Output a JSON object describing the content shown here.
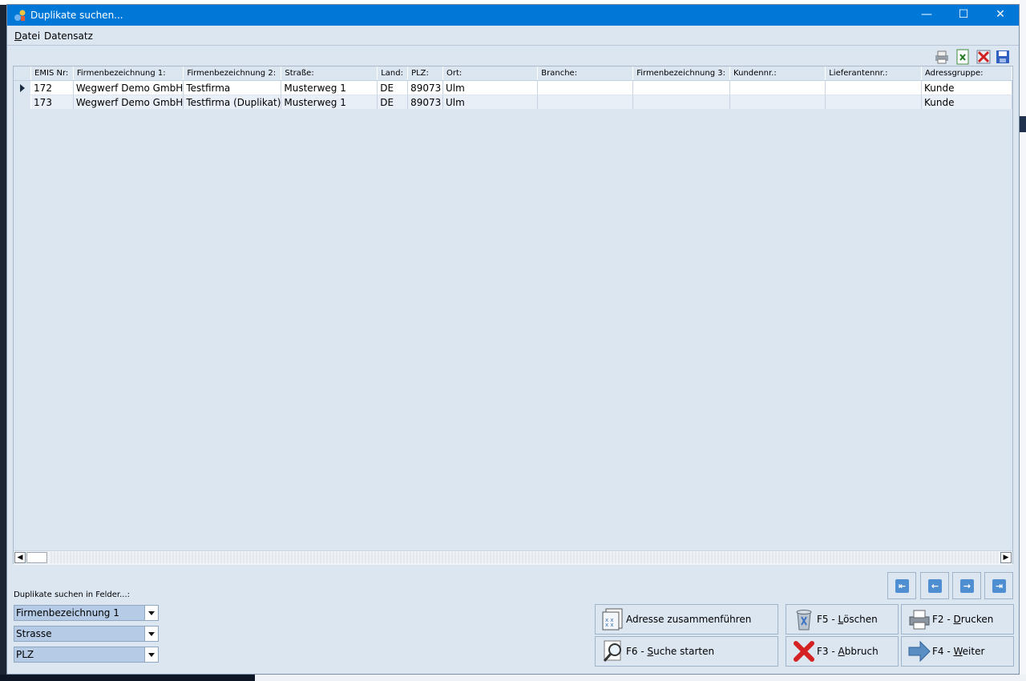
{
  "window": {
    "title": "Duplikate suchen..."
  },
  "window_controls": {
    "minimize": "—",
    "maximize": "☐",
    "close": "✕"
  },
  "menu": {
    "items": [
      {
        "ul": "D",
        "rest": "atei"
      },
      {
        "ul": "",
        "rest": "Datensatz"
      }
    ]
  },
  "grid": {
    "columns": [
      "EMIS Nr:",
      "Firmenbezeichnung 1:",
      "Firmenbezeichnung 2:",
      "Straße:",
      "Land:",
      "PLZ:",
      "Ort:",
      "Branche:",
      "Firmenbezeichnung 3:",
      "Kundennr.:",
      "Lieferantennr.:",
      "Adressgruppe:"
    ],
    "rows": [
      [
        "172",
        "Wegwerf Demo GmbH",
        "Testfirma",
        "Musterweg 1",
        "DE",
        "89073",
        "Ulm",
        "",
        "",
        "",
        "",
        "Kunde"
      ],
      [
        "173",
        "Wegwerf Demo GmbH",
        "Testfirma (Duplikat)",
        "Musterweg 1",
        "DE",
        "89073",
        "Ulm",
        "",
        "",
        "",
        "",
        "Kunde"
      ]
    ]
  },
  "search": {
    "label": "Duplikate suchen in Felder...:",
    "fields": [
      "Firmenbezeichnung 1",
      "Strasse",
      "PLZ"
    ]
  },
  "buttons": {
    "merge": {
      "pre": "Adresse zusammenführen",
      "ul": "",
      "post": ""
    },
    "delete": {
      "pre": "F5 - ",
      "ul": "L",
      "post": "öschen"
    },
    "print": {
      "pre": "F2 - ",
      "ul": "D",
      "post": "rucken"
    },
    "search": {
      "pre": "F6 - ",
      "ul": "S",
      "post": "uche starten"
    },
    "cancel": {
      "pre": "F3 - ",
      "ul": "A",
      "post": "bbruch"
    },
    "next": {
      "pre": "F4 - ",
      "ul": "W",
      "post": "eiter"
    }
  },
  "nav": {
    "first": "⇤",
    "prev": "←",
    "next": "→",
    "last": "⇥"
  },
  "colors": {
    "titlebar": "#0078d7",
    "window_bg": "#dce6f1",
    "dropdown_bg": "#b6cce6"
  }
}
